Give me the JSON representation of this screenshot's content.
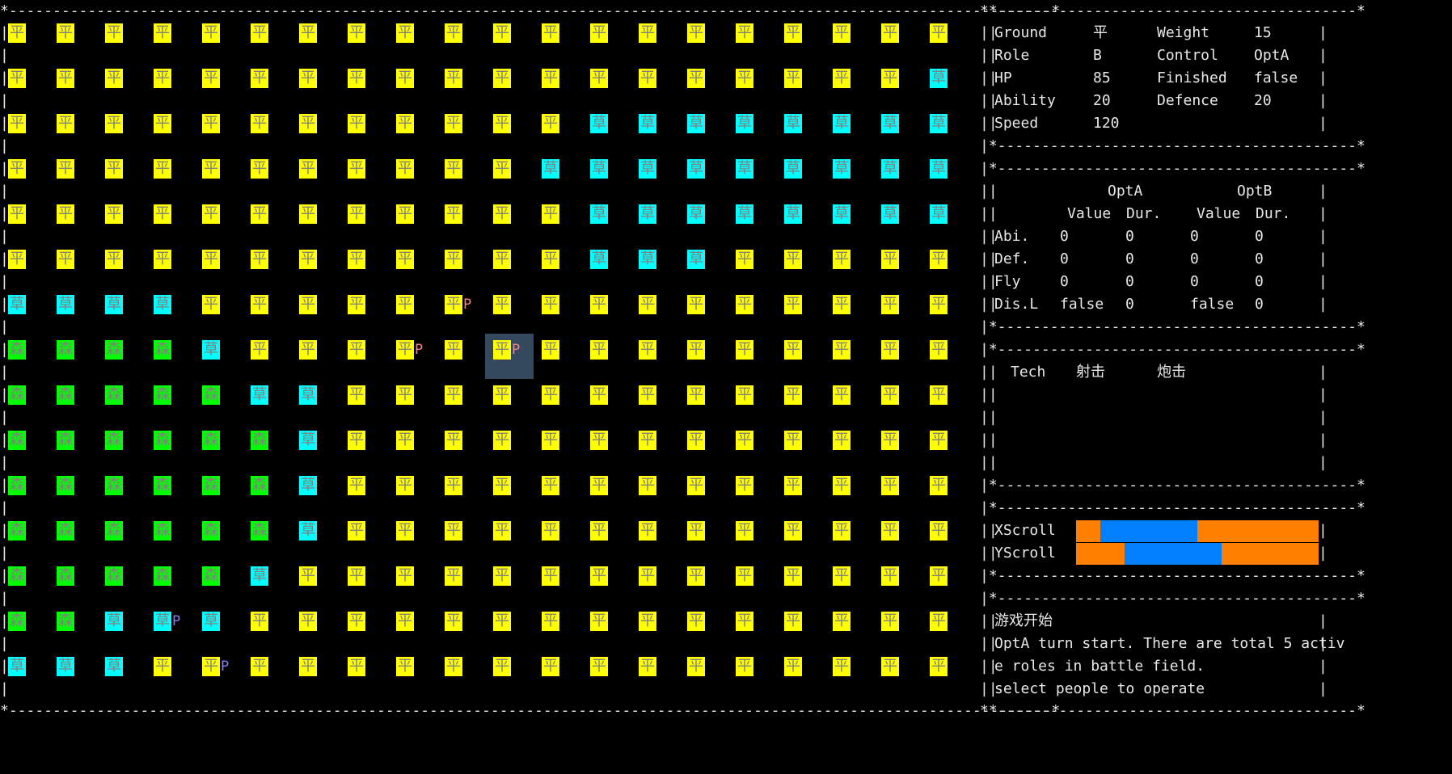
{
  "grid": {
    "rows": [
      "PPPPPPPPPPPPPPPPPPPP",
      "PPPPPPPPPPPPPPPPPPPC",
      "PPPPPPPPPPPPCCCCCCCC",
      "PPPPPPPPPPPCCCCCCCCC",
      "PPPPPPPPPPPPCCCCCCCC",
      "PPPPPPPPPPPPCCCPPPPP",
      "CCCCPPPPPPPPPPPPPPPP",
      "SSSSCPPPPPPPPPPPPPPP",
      "SSSSSCCPPPPPPPPPPPPP",
      "SSSSSSCPPPPPPPPPPPPP",
      "SSSSSSCPPPPPPPPPPPPP",
      "SSSSSSCPPPPPPPPPPPPP",
      "SSSSSCPPPPPPPPPPPPPP",
      "SSCCCPPPPPPPPPPPPPPP",
      "CCCPPPPPPPPPPPPPPPPP"
    ],
    "glyphs": {
      "P": "平",
      "C": "草",
      "S": "森"
    },
    "colors": {
      "P": "#ffff00",
      "C": "#00ffff",
      "S": "#00ff00"
    },
    "units": [
      {
        "row": 6,
        "col": 9,
        "label": "P",
        "color": "#ff8080"
      },
      {
        "row": 7,
        "col": 8,
        "label": "P",
        "color": "#ff8080"
      },
      {
        "row": 7,
        "col": 10,
        "label": "P",
        "color": "#ff8080"
      },
      {
        "row": 13,
        "col": 3,
        "label": "P",
        "color": "#8080ff"
      },
      {
        "row": 14,
        "col": 4,
        "label": "P",
        "color": "#8080ff"
      }
    ],
    "cursor": {
      "row": 7,
      "col": 10,
      "color": "#34495e"
    }
  },
  "info": {
    "ground_label": "Ground",
    "ground_value": "平",
    "weight_label": "Weight",
    "weight_value": "15",
    "role_label": "Role",
    "role_value": "B",
    "control_label": "Control",
    "control_value": "OptA",
    "hp_label": "HP",
    "hp_value": "85",
    "finished_label": "Finished",
    "finished_value": "false",
    "ability_label": "Ability",
    "ability_value": "20",
    "defence_label": "Defence",
    "defence_value": "20",
    "speed_label": "Speed",
    "speed_value": "120"
  },
  "buffs": {
    "opt_a": "OptA",
    "opt_b": "OptB",
    "value_header": "Value",
    "dur_header": "Dur.",
    "rows": [
      {
        "label": "Abi.",
        "a_value": "0",
        "a_dur": "0",
        "b_value": "0",
        "b_dur": "0"
      },
      {
        "label": "Def.",
        "a_value": "0",
        "a_dur": "0",
        "b_value": "0",
        "b_dur": "0"
      },
      {
        "label": "Fly",
        "a_value": "0",
        "a_dur": "0",
        "b_value": "0",
        "b_dur": "0"
      },
      {
        "label": "Dis.L",
        "a_value": "false",
        "a_dur": "0",
        "b_value": "false",
        "b_dur": "0"
      }
    ]
  },
  "tech": {
    "label": "Tech",
    "items": [
      "射击",
      "炮击"
    ]
  },
  "scroll": {
    "x_label": "XScroll",
    "y_label": "YScroll",
    "track_color": "#ff8000",
    "thumb_color": "#0080ff",
    "x_thumb_start": 0.1,
    "x_thumb_end": 0.5,
    "y_thumb_start": 0.2,
    "y_thumb_end": 0.6
  },
  "log": {
    "lines": [
      "游戏开始",
      "OptA turn start. There are total 5 activ",
      "e roles in battle field.",
      "select people to operate"
    ]
  }
}
